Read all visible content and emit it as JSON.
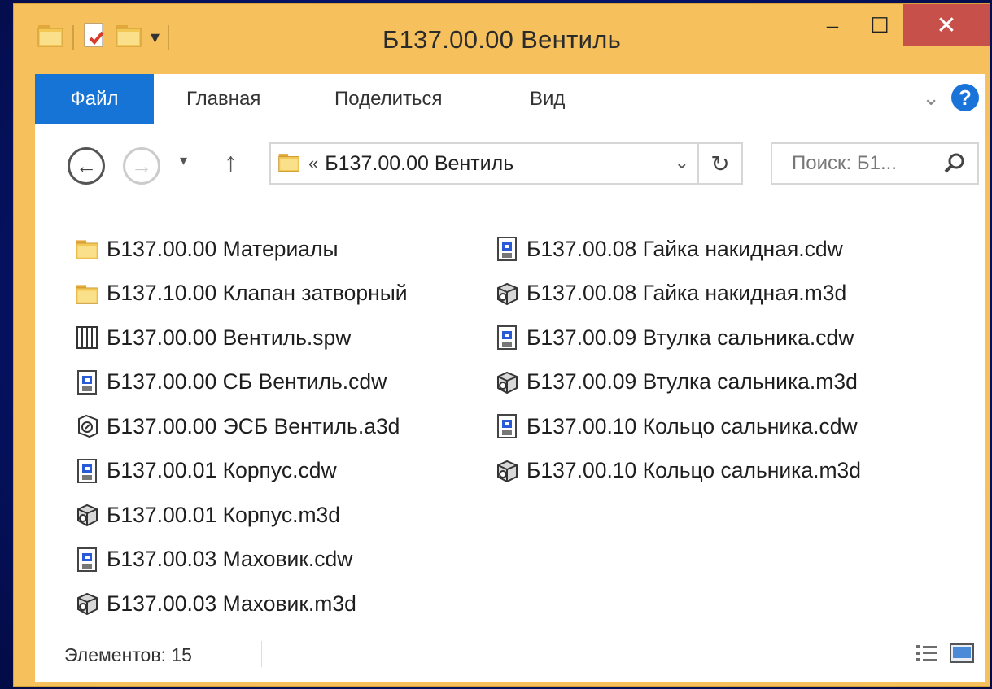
{
  "window": {
    "title": "Б137.00.00 Вентиль"
  },
  "titlebar": {
    "minimize": "–",
    "maximize": "☐",
    "close": "✕"
  },
  "ribbon": {
    "tabs": [
      {
        "label": "Файл"
      },
      {
        "label": "Главная"
      },
      {
        "label": "Поделиться"
      },
      {
        "label": "Вид"
      }
    ],
    "expand": "⌄",
    "help": "?"
  },
  "nav": {
    "back": "←",
    "forward": "→",
    "recent": "▾",
    "up": "↑",
    "address_prefix": "«",
    "address": "Б137.00.00 Вентиль",
    "address_dropdown": "⌄",
    "refresh": "↻",
    "search_placeholder": "Поиск: Б1..."
  },
  "files": {
    "column1": [
      {
        "name": "Б137.00.00 Материалы",
        "icon": "folder-icon"
      },
      {
        "name": "Б137.10.00 Клапан затворный",
        "icon": "folder-icon"
      },
      {
        "name": "Б137.00.00 Вентиль.spw",
        "icon": "spec-icon"
      },
      {
        "name": "Б137.00.00 СБ Вентиль.cdw",
        "icon": "drawing-icon"
      },
      {
        "name": "Б137.00.00 ЭСБ Вентиль.a3d",
        "icon": "assembly-icon"
      },
      {
        "name": "Б137.00.01 Корпус.cdw",
        "icon": "drawing-icon"
      },
      {
        "name": "Б137.00.01 Корпус.m3d",
        "icon": "part-icon"
      },
      {
        "name": "Б137.00.03 Маховик.cdw",
        "icon": "drawing-icon"
      },
      {
        "name": "Б137.00.03 Маховик.m3d",
        "icon": "part-icon"
      }
    ],
    "column2": [
      {
        "name": "Б137.00.08 Гайка накидная.cdw",
        "icon": "drawing-icon"
      },
      {
        "name": "Б137.00.08 Гайка накидная.m3d",
        "icon": "part-icon"
      },
      {
        "name": "Б137.00.09 Втулка сальника.cdw",
        "icon": "drawing-icon"
      },
      {
        "name": "Б137.00.09 Втулка сальника.m3d",
        "icon": "part-icon"
      },
      {
        "name": "Б137.00.10 Кольцо сальника.cdw",
        "icon": "drawing-icon"
      },
      {
        "name": "Б137.00.10 Кольцо сальника.m3d",
        "icon": "part-icon"
      }
    ]
  },
  "status": {
    "count": "Элементов: 15"
  },
  "colors": {
    "frame": "#f6c15c",
    "file_tab": "#1674d6",
    "close": "#c7504a",
    "background": "#06146a"
  }
}
